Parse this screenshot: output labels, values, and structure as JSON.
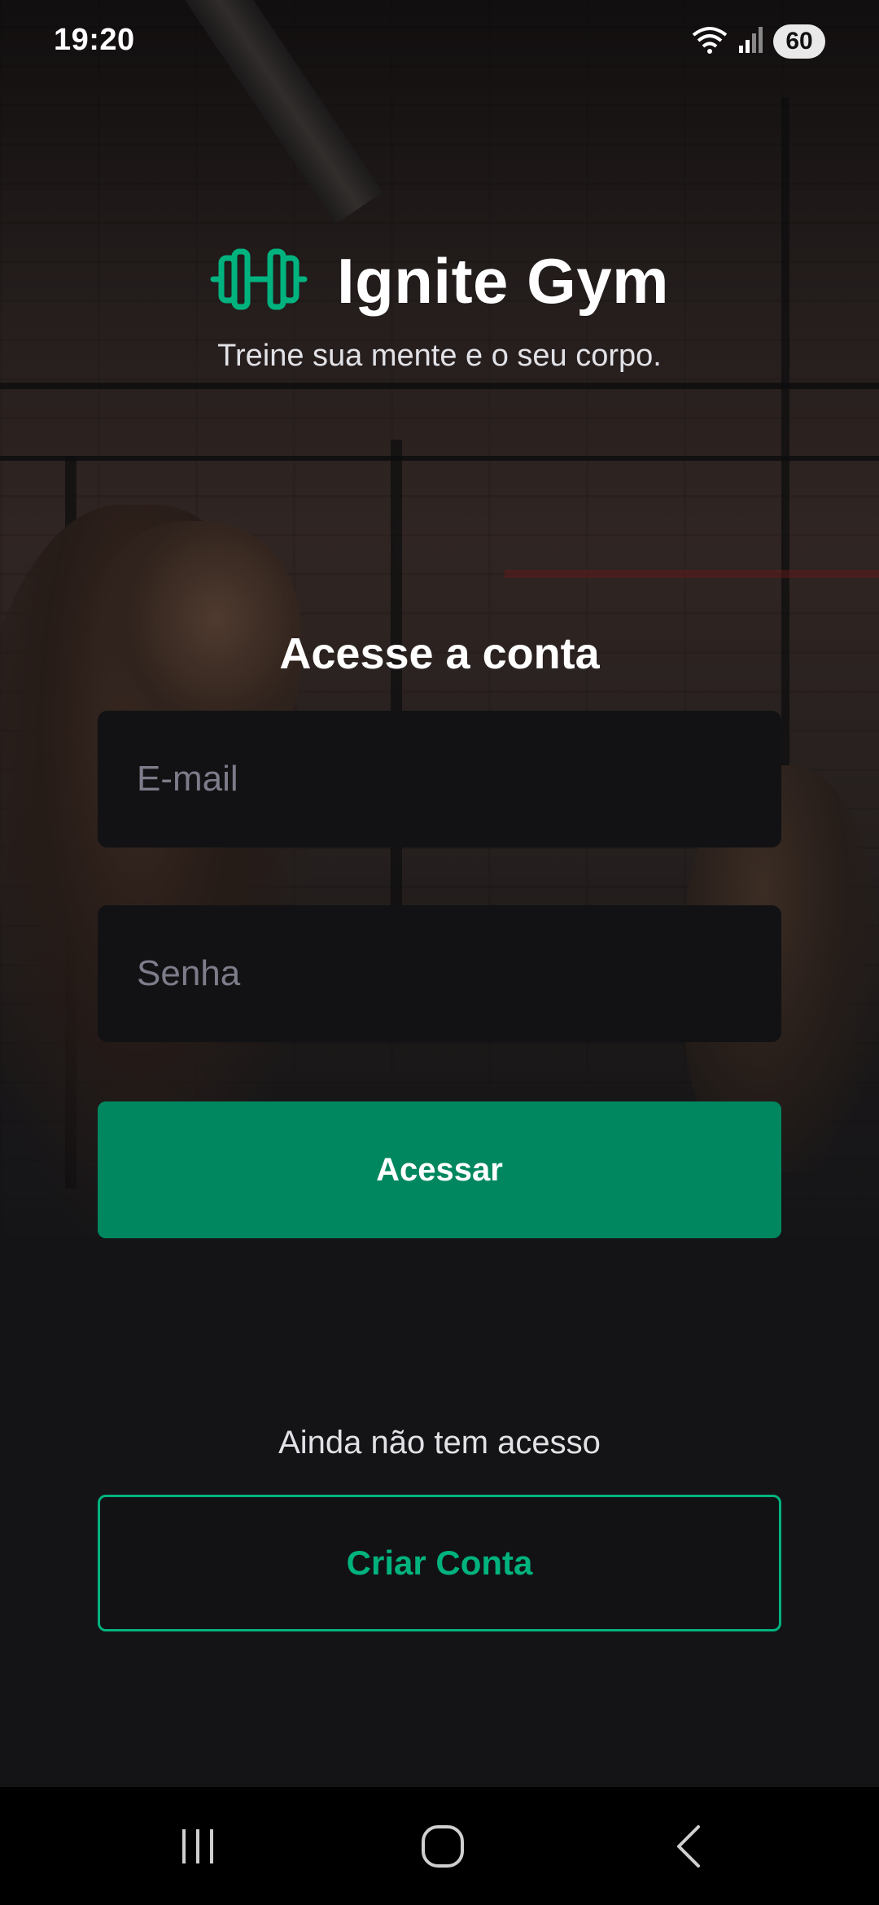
{
  "status_bar": {
    "time": "19:20",
    "battery": "60",
    "icons": [
      "wifi-icon",
      "signal-icon",
      "battery-icon"
    ]
  },
  "brand": {
    "name": "Ignite Gym",
    "tagline": "Treine sua mente e o seu corpo.",
    "icon": "dumbbell-icon",
    "accent_color": "#00b37e"
  },
  "login_form": {
    "title": "Acesse a conta",
    "email_placeholder": "E-mail",
    "password_placeholder": "Senha",
    "submit_label": "Acessar",
    "primary_color": "#00875f"
  },
  "signup": {
    "hint": "Ainda não tem acesso",
    "button_label": "Criar Conta"
  },
  "nav_bar": {
    "buttons": [
      "recent-apps-icon",
      "home-icon",
      "back-icon"
    ]
  }
}
